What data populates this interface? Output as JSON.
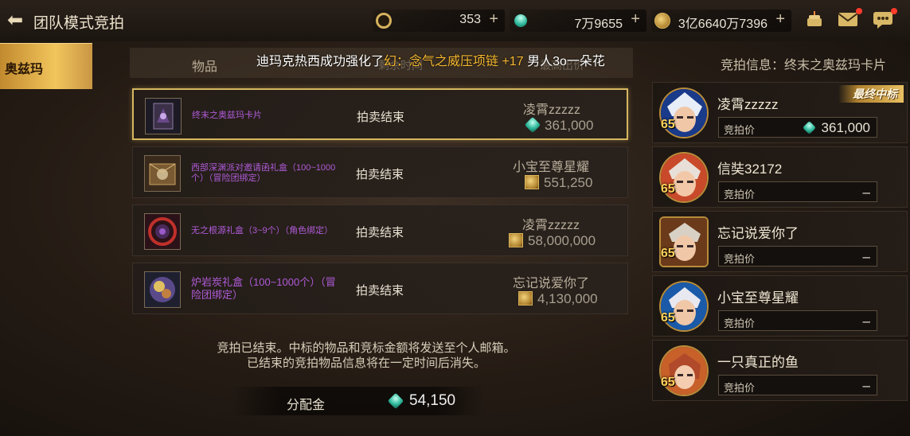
{
  "header": {
    "title": "团队模式竞拍"
  },
  "currencies": [
    {
      "icon": "coupon-icon",
      "value": "353"
    },
    {
      "icon": "gem-icon",
      "value": "7万9655"
    },
    {
      "icon": "gold-coin-icon",
      "value": "3亿6640万7396"
    }
  ],
  "plus_symbol": "+",
  "top_icons": [
    "cake-icon",
    "mail-icon",
    "chat-icon"
  ],
  "sidebar": {
    "tabs": [
      {
        "label": "奥兹玛"
      }
    ]
  },
  "table": {
    "col_item": "物品",
    "col_status": "剩余时间",
    "col_max": "最高出价"
  },
  "ticker": {
    "prefix": "迪玛克热西成功强化了",
    "item": "幻：念气之威压项链 +17",
    "suffix": "男人3o一朵花"
  },
  "items": [
    {
      "name": "终末之奥兹玛卡片",
      "status": "拍卖结束",
      "winner": "凌霄zzzzz",
      "currency": "gem",
      "price": "361,000",
      "icon": "card-icon"
    },
    {
      "name": "西部深渊派对邀请函礼盒（100~1000个）（冒险团绑定）",
      "status": "拍卖结束",
      "winner": "小宝至尊星耀",
      "currency": "gold",
      "price": "551,250",
      "icon": "invitation-box-icon"
    },
    {
      "name": "无之根源礼盒（3~9个）（角色绑定）",
      "status": "拍卖结束",
      "winner": "凌霄zzzzz",
      "currency": "gold",
      "price": "58,000,000",
      "icon": "void-origin-box-icon"
    },
    {
      "name": "炉岩炭礼盒（100~1000个）（冒险团绑定）",
      "status": "拍卖结束",
      "winner": "忘记说爱你了",
      "currency": "gold",
      "price": "4,130,000",
      "icon": "fire-stone-box-icon"
    }
  ],
  "notice": {
    "line1": "竞拍已结束。中标的物品和竞标金额将发送至个人邮箱。",
    "line2": "已结束的竞拍物品信息将在一定时间后消失。"
  },
  "payout": {
    "label": "分配金",
    "amount": "54,150"
  },
  "right_panel": {
    "title": "竞拍信息：终末之奥兹玛卡片",
    "bid_label": "竞拍价",
    "empty_value": "–",
    "win_badge": "最终中标"
  },
  "bidders": [
    {
      "name": "凌霄zzzzz",
      "level": "65",
      "price": "361,000",
      "winner": true
    },
    {
      "name": "信奘32172",
      "level": "65",
      "price": null,
      "winner": false
    },
    {
      "name": "忘记说爱你了",
      "level": "65",
      "price": null,
      "winner": false
    },
    {
      "name": "小宝至尊星耀",
      "level": "65",
      "price": null,
      "winner": false
    },
    {
      "name": "一只真正的鱼",
      "level": "65",
      "price": null,
      "winner": false
    }
  ],
  "colors": {
    "gold": "#d6b760",
    "purple_item": "#b05bd8",
    "accent_tab": "#f2c55c"
  }
}
